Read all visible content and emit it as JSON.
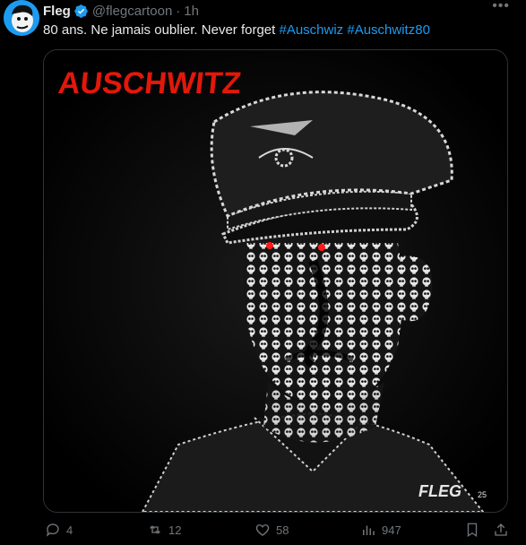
{
  "author": {
    "name": "Fleg",
    "handle": "@flegcartoon",
    "separator": "·",
    "time": "1h"
  },
  "tweet": {
    "text": "80 ans. Ne jamais oublier. Never forget",
    "hashtags": [
      "#Auschwiz",
      "#Auschwitz80"
    ]
  },
  "media": {
    "title": "AUSCHWITZ",
    "signature": "FLEG",
    "signature_year": "25",
    "title_color": "#e3170a"
  },
  "actions": {
    "replies": "4",
    "reposts": "12",
    "likes": "58",
    "views": "947"
  },
  "colors": {
    "accent": "#1d9bf0",
    "muted": "#71767b",
    "text": "#e7e9ea"
  }
}
